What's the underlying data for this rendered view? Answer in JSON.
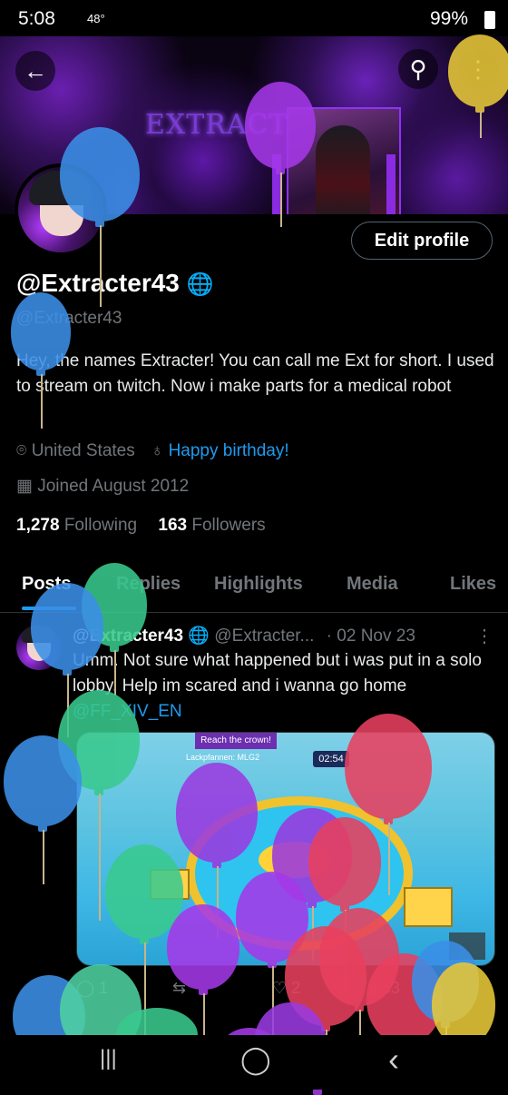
{
  "status_bar": {
    "time": "5:08",
    "temperature": "48°",
    "battery": "99%"
  },
  "banner": {
    "name_text": "EXTRACTER 43"
  },
  "profile": {
    "edit_label": "Edit profile",
    "display_name": "@Extracter43",
    "handle": "@Extracter43",
    "bio": "Hey, the names Extracter!  You can call me Ext for short.  I used to stream on twitch.  Now i make parts for a medical robot",
    "location": "United States",
    "birthday": "Happy birthday!",
    "joined": "Joined August 2012",
    "following_count": "1,278",
    "following_label": "Following",
    "followers_count": "163",
    "followers_label": "Followers"
  },
  "tabs": [
    "Posts",
    "Replies",
    "Highlights",
    "Media",
    "Likes"
  ],
  "tweet": {
    "name": "@Extracter43",
    "handle": "@Extracter...",
    "date": "· 02 Nov 23",
    "text_before": "Umm.  Not sure what happened but i was put in a solo lobby.  Help im scared and i wanna go home ",
    "mention": "@FF_XIV_EN",
    "media": {
      "banner_text": "Reach the crown!",
      "timer": "02:54",
      "lobby_text": "Lackpfannen: MLG2"
    },
    "reply_count": "1",
    "like_count": "2",
    "view_count": "53"
  },
  "icons": {
    "back": "←",
    "search": "⚲",
    "more": "⋮",
    "location": "⌾",
    "birthday": "♁",
    "calendar": "▦",
    "reply": "◯",
    "retweet": "⇆",
    "like": "♡",
    "views": "▮",
    "nav_recent": "|||",
    "nav_home": "◯",
    "nav_back": "‹"
  },
  "colors": {
    "accent": "#1d9bf0",
    "muted": "#71767b",
    "background": "#000000"
  },
  "balloon_colors": [
    "#3b8fe8",
    "#a538e8",
    "#e8c838",
    "#39c98e",
    "#e8405e",
    "#9a3ae0",
    "#4fd0a0"
  ]
}
